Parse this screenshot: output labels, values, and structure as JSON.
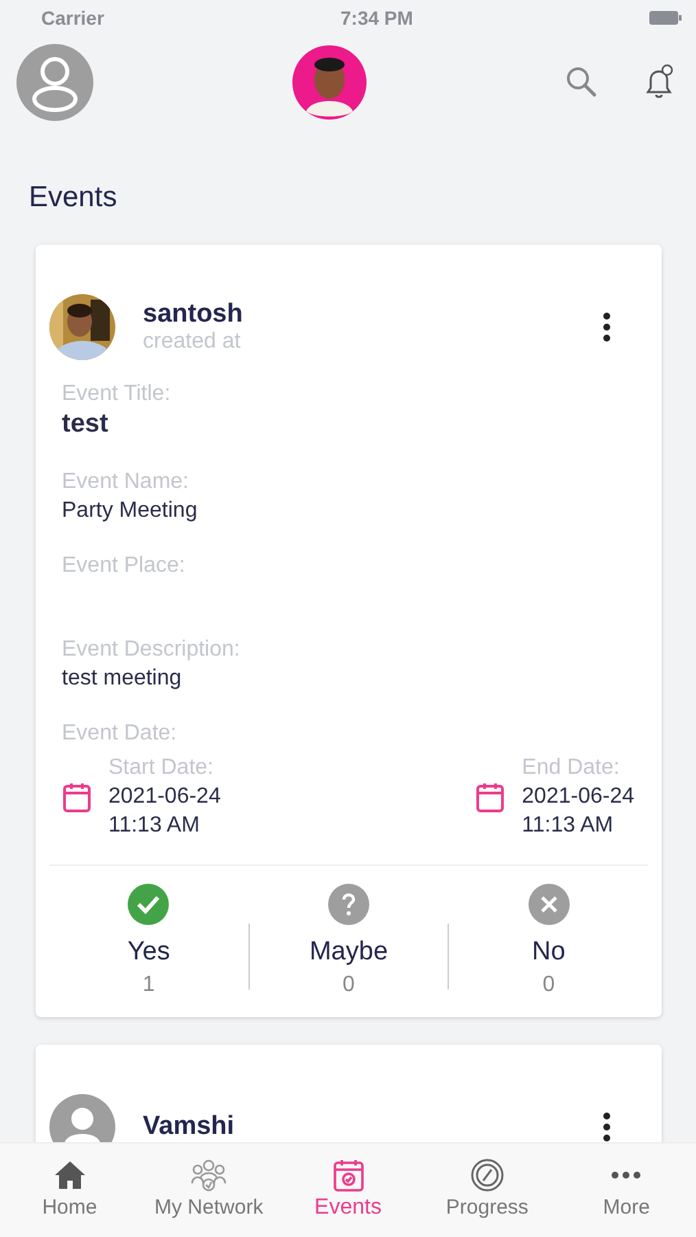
{
  "status_bar": {
    "carrier": "Carrier",
    "time": "7:34 PM"
  },
  "page_title": "Events",
  "events": [
    {
      "user": "santosh",
      "subtitle": "created at",
      "fields": [
        {
          "label": "Event Title:",
          "value": "test",
          "kind": "heading"
        },
        {
          "label": "Event Name:",
          "value": "Party Meeting",
          "kind": "text"
        },
        {
          "label": "Event Place:",
          "kind": "text"
        },
        {
          "label": "Event Description:",
          "value": "test meeting",
          "kind": "text"
        }
      ],
      "date_label": "Event Date:",
      "dates": [
        {
          "label": "Start Date:",
          "date": "2021-06-24",
          "time": "11:13 AM"
        },
        {
          "label": "End Date:",
          "date": "2021-06-24",
          "time": "11:13 AM"
        }
      ],
      "responses": [
        {
          "kind": "yes",
          "label": "Yes",
          "count": "1",
          "selected": true
        },
        {
          "kind": "maybe",
          "label": "Maybe",
          "count": "0",
          "selected": false
        },
        {
          "kind": "no",
          "label": "No",
          "count": "0",
          "selected": false
        }
      ]
    },
    {
      "user": "Vamshi",
      "kind": "default"
    }
  ],
  "tabs": [
    {
      "label": "Home",
      "kind": "home",
      "selected": false
    },
    {
      "label": "My Network",
      "kind": "network",
      "selected": false
    },
    {
      "label": "Events",
      "kind": "calendar",
      "selected": true
    },
    {
      "label": "Progress",
      "kind": "gauge",
      "selected": false
    },
    {
      "label": "More",
      "kind": "dots",
      "selected": false
    }
  ]
}
